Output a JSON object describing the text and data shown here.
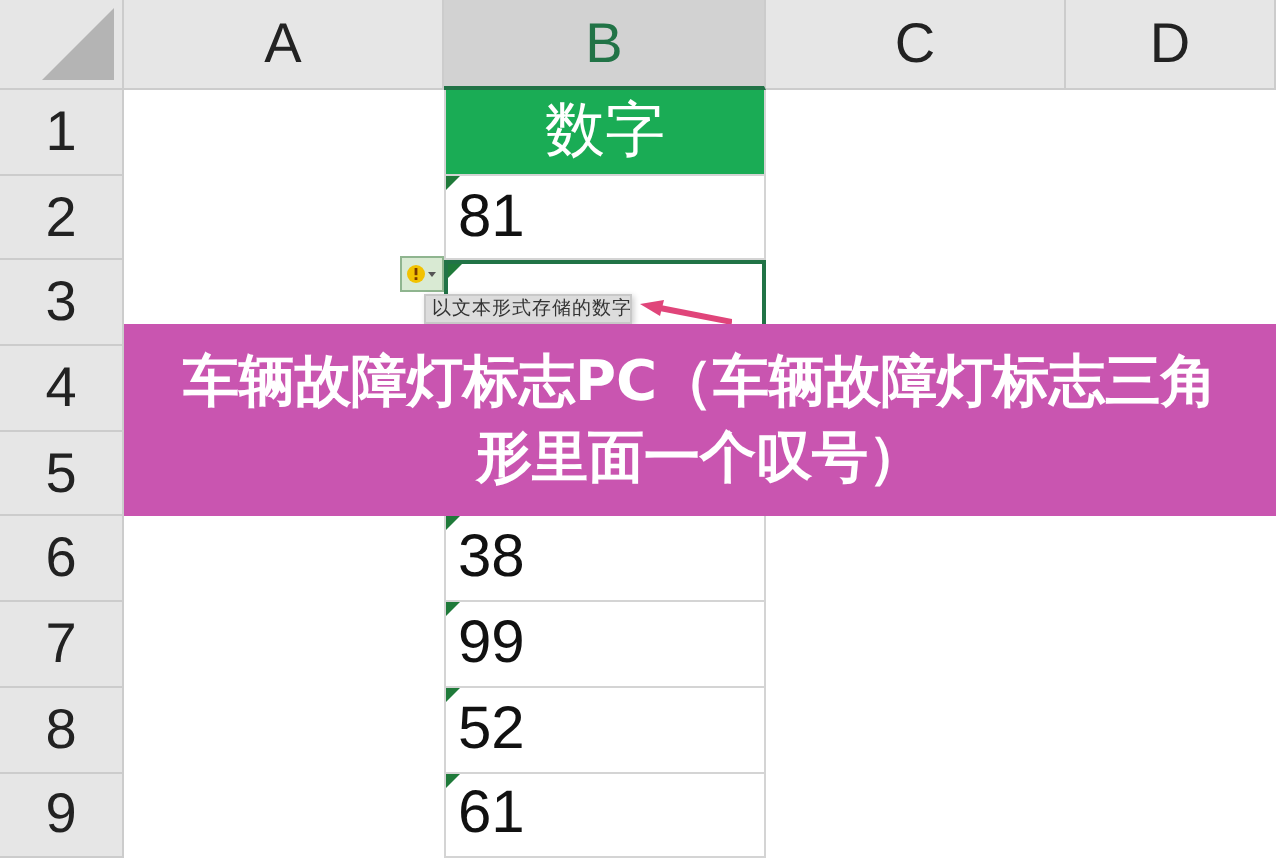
{
  "columns": [
    "A",
    "B",
    "C",
    "D"
  ],
  "rows": [
    {
      "number": "1",
      "b": "数字",
      "kind": "header",
      "flagged": false,
      "selected": false
    },
    {
      "number": "2",
      "b": "81",
      "kind": "value",
      "flagged": true,
      "selected": false
    },
    {
      "number": "3",
      "kind": "value",
      "flagged": true,
      "selected": true
    },
    {
      "number": "4",
      "kind": "value",
      "flagged": false,
      "selected": false
    },
    {
      "number": "5",
      "kind": "value",
      "flagged": false,
      "selected": false
    },
    {
      "number": "6",
      "b": "38",
      "kind": "value",
      "flagged": true,
      "selected": false
    },
    {
      "number": "7",
      "b": "99",
      "kind": "value",
      "flagged": true,
      "selected": false
    },
    {
      "number": "8",
      "b": "52",
      "kind": "value",
      "flagged": true,
      "selected": false
    },
    {
      "number": "9",
      "b": "61",
      "kind": "value",
      "flagged": true,
      "selected": false
    }
  ],
  "error_menu": {
    "title": "以文本形式存储的数字"
  },
  "banner": {
    "text": "车辆故障灯标志PC（车辆故障灯标志三角形里面一个叹号）"
  }
}
